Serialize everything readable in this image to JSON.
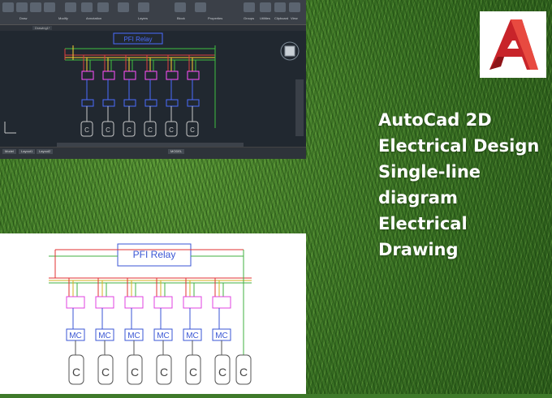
{
  "colors": {
    "accent_red": "#e0302f",
    "canvas_bg": "#212830",
    "grass": "#3f7a2a",
    "text": "#ffffff"
  },
  "autocad": {
    "ribbon_labels": [
      "Draw",
      "Modify",
      "Annotation",
      "Layers",
      "Block",
      "Properties",
      "Groups",
      "Utilities",
      "Clipboard",
      "View"
    ],
    "file_tab": "Drawing1*",
    "model_tabs": [
      "Model",
      "Layout1",
      "Layout2"
    ],
    "status_text": "MODEL",
    "diagram_title": "PFI Relay",
    "motor_label": "C",
    "contactor_label": "MC"
  },
  "paper_drawing": {
    "relay_label": "PFI Relay",
    "contactor_label": "MC",
    "motor_label": "C",
    "units": 6
  },
  "tagline": {
    "line1": "AutoCad 2D",
    "line2": "Electrical Design",
    "line3": "Single-line",
    "line4": "diagram",
    "line5": "Electrical",
    "line6": "Drawing"
  },
  "logo": {
    "icon": "autocad-logo-icon"
  }
}
